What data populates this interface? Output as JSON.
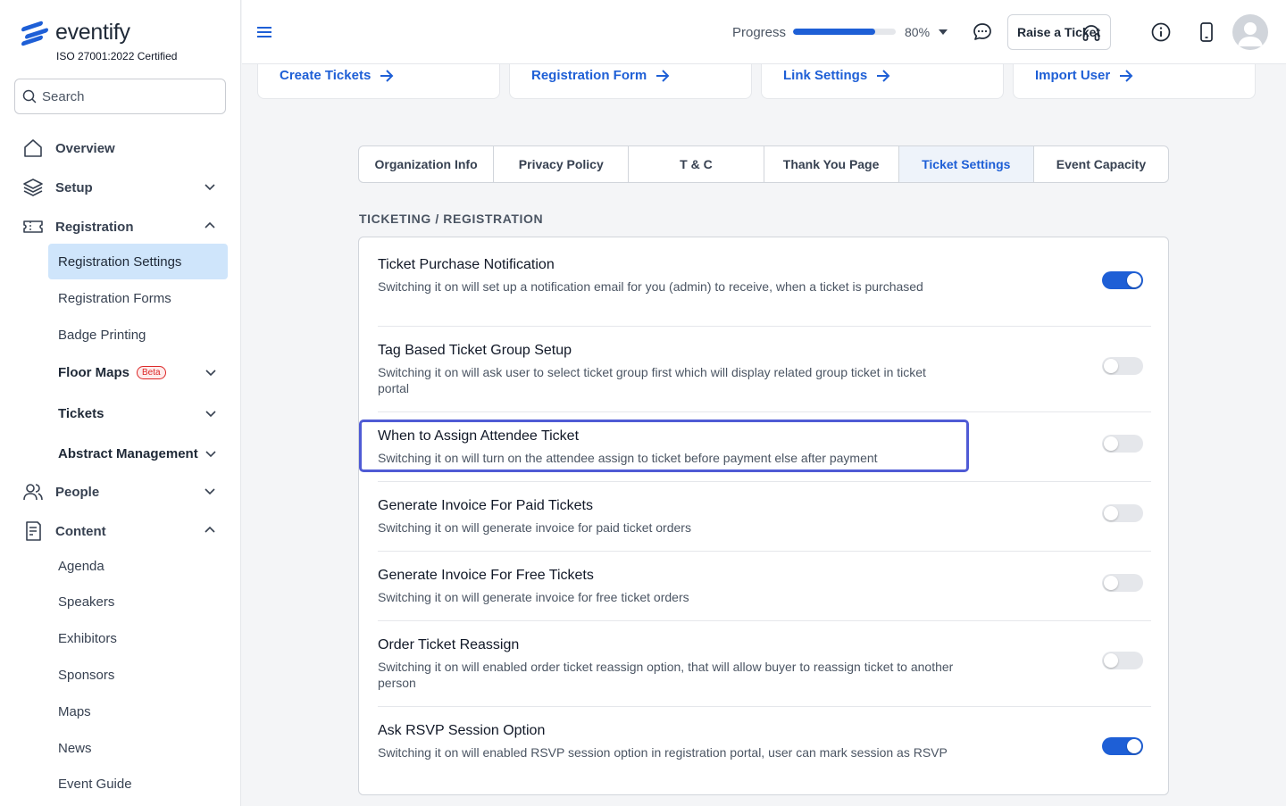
{
  "brand": {
    "name": "eventify",
    "certification": "ISO 27001:2022 Certified",
    "color": "#1e5fd6"
  },
  "search": {
    "placeholder": "Search"
  },
  "sidebar": {
    "items": [
      {
        "label": "Overview",
        "icon": "home-icon"
      },
      {
        "label": "Setup",
        "icon": "layers-icon"
      },
      {
        "label": "Registration",
        "icon": "ticket-icon"
      },
      {
        "label": "People",
        "icon": "users-icon"
      },
      {
        "label": "Content",
        "icon": "document-icon"
      }
    ],
    "registration_sub": [
      {
        "label": "Registration Settings",
        "active": true
      },
      {
        "label": "Registration Forms"
      },
      {
        "label": "Badge Printing"
      },
      {
        "label": "Floor Maps",
        "badge": "Beta"
      },
      {
        "label": "Tickets"
      },
      {
        "label": "Abstract Management"
      }
    ],
    "content_sub": [
      {
        "label": "Agenda"
      },
      {
        "label": "Speakers"
      },
      {
        "label": "Exhibitors"
      },
      {
        "label": "Sponsors"
      },
      {
        "label": "Maps"
      },
      {
        "label": "News"
      },
      {
        "label": "Event Guide"
      }
    ]
  },
  "topbar": {
    "progress_label": "Progress",
    "progress_value": 0.8,
    "progress_text": "80%",
    "raise_ticket": "Raise a Ticket"
  },
  "quick_links": [
    {
      "label": "Create Tickets"
    },
    {
      "label": "Registration Form"
    },
    {
      "label": "Link Settings"
    },
    {
      "label": "Import User"
    }
  ],
  "tabs": [
    {
      "label": "Organization Info"
    },
    {
      "label": "Privacy Policy"
    },
    {
      "label": "T & C"
    },
    {
      "label": "Thank You Page"
    },
    {
      "label": "Ticket Settings",
      "active": true
    },
    {
      "label": "Event Capacity"
    }
  ],
  "section_title": "TICKETING / REGISTRATION",
  "settings": [
    {
      "title": "Ticket Purchase Notification",
      "desc": "Switching it on will set up a notification email for you (admin) to receive, when a ticket is purchased",
      "enabled": true
    },
    {
      "title": "Tag Based Ticket Group Setup",
      "desc": "Switching it on will ask user to select ticket group first which will display related group ticket in ticket portal",
      "enabled": false
    },
    {
      "title": "When to Assign Attendee Ticket",
      "desc": "Switching it on will turn on the attendee assign to ticket before payment else after payment",
      "enabled": false
    },
    {
      "title": "Generate Invoice For Paid Tickets",
      "desc": "Switching it on will generate invoice for paid ticket orders",
      "enabled": false
    },
    {
      "title": "Generate Invoice For Free Tickets",
      "desc": "Switching it on will generate invoice for free ticket orders",
      "enabled": false
    },
    {
      "title": "Order Ticket Reassign",
      "desc": "Switching it on will enabled order ticket reassign option, that will allow buyer to reassign ticket to another person",
      "enabled": false
    },
    {
      "title": "Ask RSVP Session Option",
      "desc": "Switching it on will enabled RSVP session option in registration portal, user can mark session as RSVP",
      "enabled": true
    }
  ]
}
